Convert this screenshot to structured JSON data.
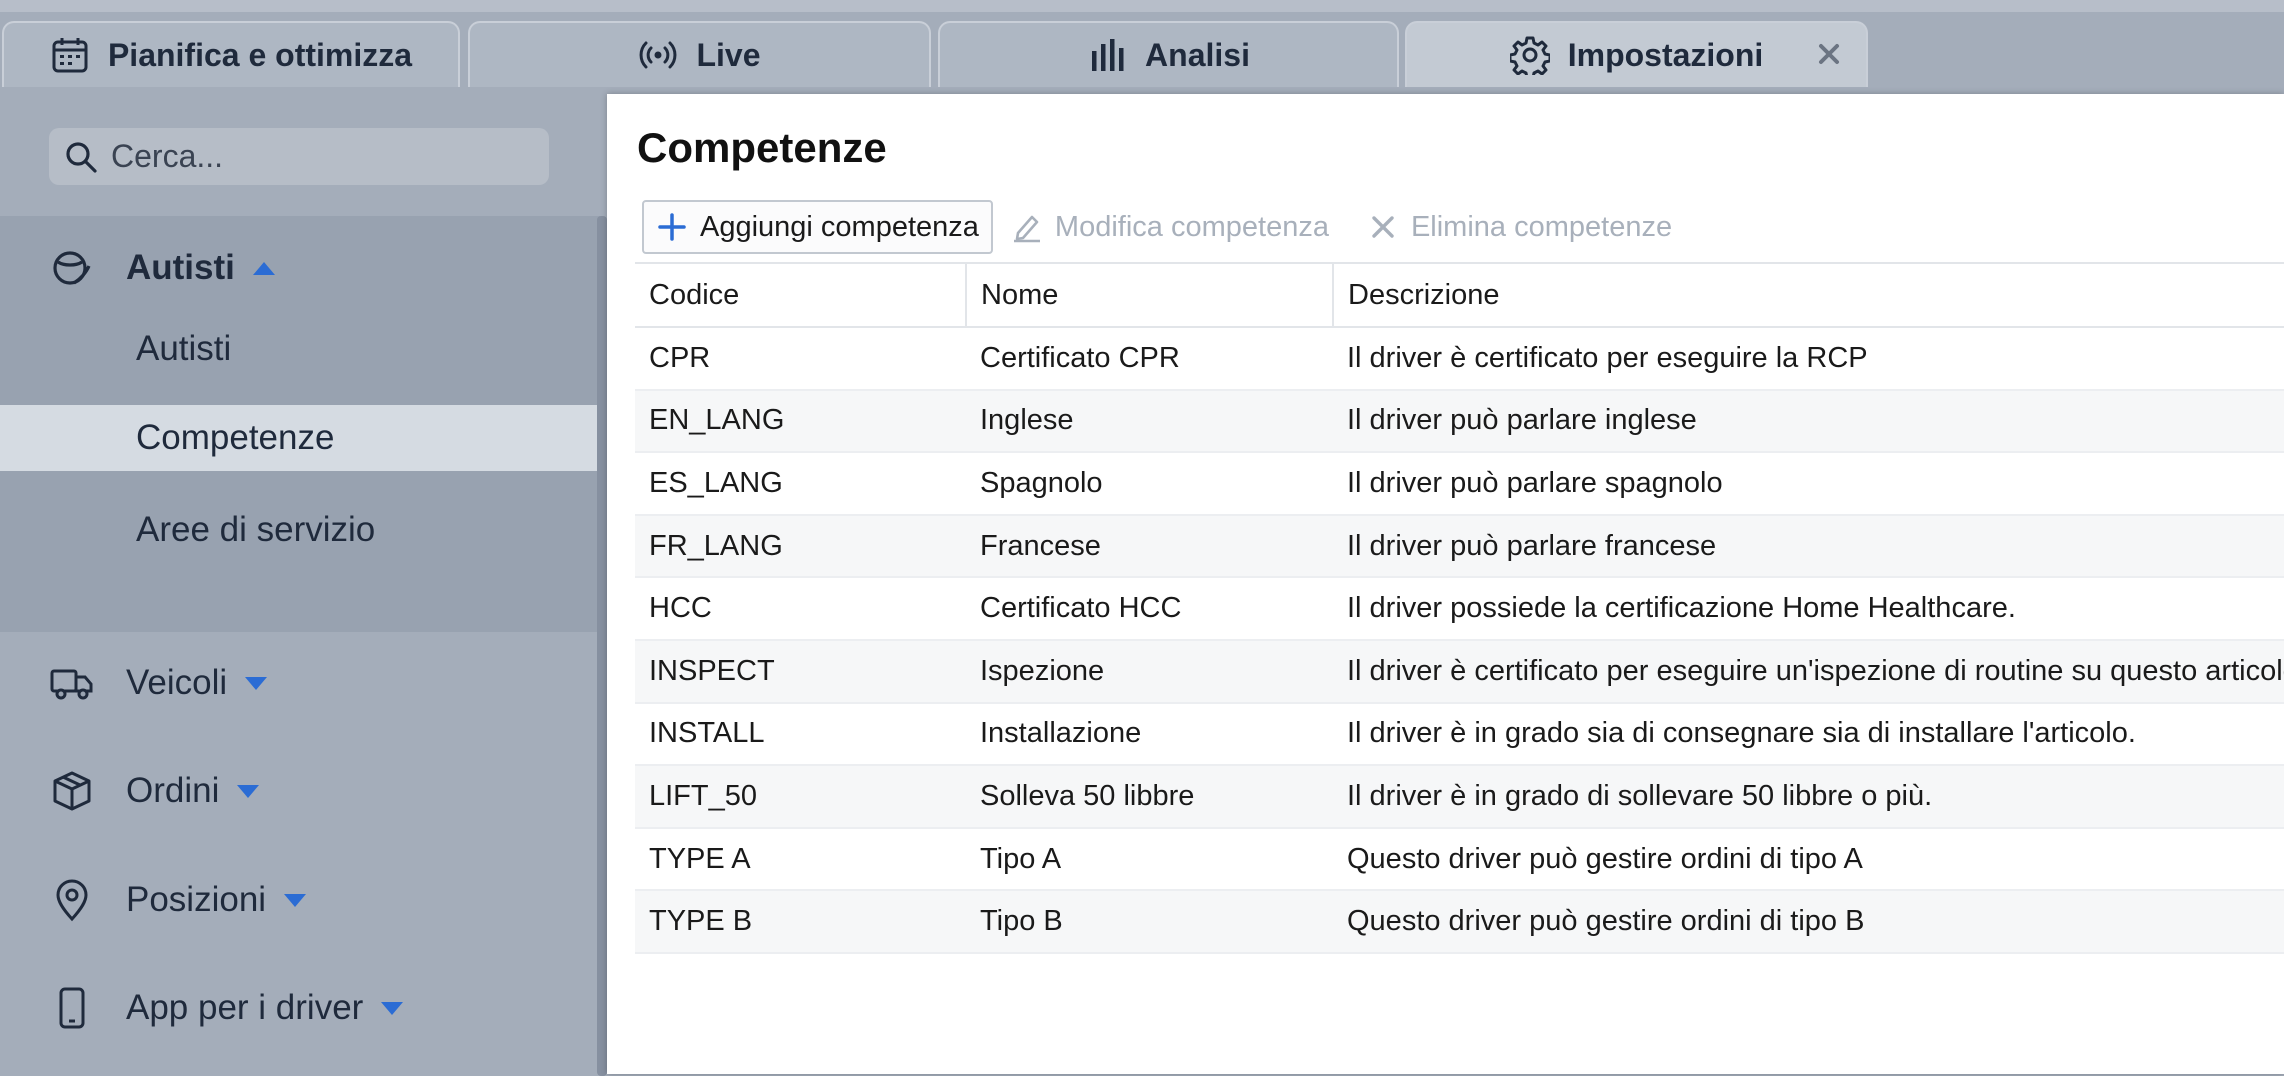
{
  "tabs": [
    {
      "label": "Pianifica e ottimizza",
      "icon": "calendar-icon"
    },
    {
      "label": "Live",
      "icon": "broadcast-icon"
    },
    {
      "label": "Analisi",
      "icon": "bar-chart-icon"
    },
    {
      "label": "Impostazioni",
      "icon": "gear-icon",
      "active": true
    }
  ],
  "sidebar": {
    "search_placeholder": "Cerca...",
    "groups": [
      {
        "label": "Autisti",
        "icon": "steering-wheel-icon",
        "expanded": true,
        "items": [
          "Autisti",
          "Competenze",
          "Aree di servizio"
        ],
        "selected": "Competenze"
      },
      {
        "label": "Veicoli",
        "icon": "truck-icon"
      },
      {
        "label": "Ordini",
        "icon": "package-icon"
      },
      {
        "label": "Posizioni",
        "icon": "location-pin-icon"
      },
      {
        "label": "App per i driver",
        "icon": "phone-icon"
      }
    ]
  },
  "main": {
    "title": "Competenze",
    "toolbar": {
      "add": "Aggiungi competenza",
      "edit": "Modifica competenza",
      "delete": "Elimina competenze"
    },
    "table": {
      "columns": [
        "Codice",
        "Nome",
        "Descrizione"
      ],
      "rows": [
        [
          "CPR",
          "Certificato CPR",
          "Il driver è certificato per eseguire la RCP"
        ],
        [
          "EN_LANG",
          "Inglese",
          "Il driver può parlare inglese"
        ],
        [
          "ES_LANG",
          "Spagnolo",
          "Il driver può parlare spagnolo"
        ],
        [
          "FR_LANG",
          "Francese",
          "Il driver può parlare francese"
        ],
        [
          "HCC",
          "Certificato HCC",
          "Il driver possiede la certificazione Home Healthcare."
        ],
        [
          "INSPECT",
          "Ispezione",
          "Il driver è certificato per eseguire un'ispezione di routine su questo articolo."
        ],
        [
          "INSTALL",
          "Installazione",
          "Il driver è in grado sia di consegnare sia di installare l'articolo."
        ],
        [
          "LIFT_50",
          "Solleva 50 libbre",
          "Il driver è in grado di sollevare 50 libbre o più."
        ],
        [
          "TYPE A",
          "Tipo A",
          "Questo driver può gestire ordini di tipo A"
        ],
        [
          "TYPE B",
          "Tipo B",
          "Questo driver può gestire ordini di tipo B"
        ]
      ]
    }
  },
  "colors": {
    "accent": "#2b6cd4",
    "selected_bg": "#d5dbe2",
    "disabled": "#a8b0bb"
  }
}
